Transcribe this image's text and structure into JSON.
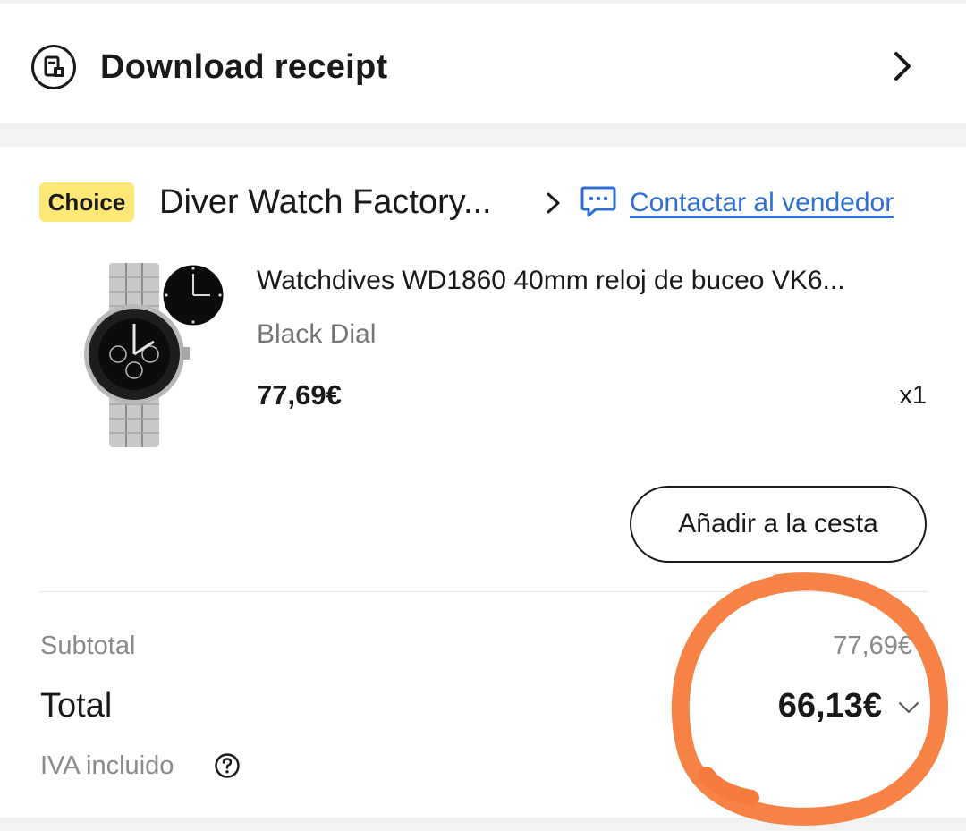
{
  "receipt": {
    "icon": "receipt-icon",
    "title": "Download receipt",
    "chevron_icon": "chevron-right-icon"
  },
  "store": {
    "badge": "Choice",
    "badge_color": "#fde777",
    "name": "Diver Watch Factory...",
    "contact_icon": "chat-icon",
    "contact_label": "Contactar al vendedor",
    "link_color": "#2e6fd6"
  },
  "product": {
    "title": "Watchdives WD1860 40mm reloj de buceo VK6...",
    "variant": "Black Dial",
    "price": "77,69€",
    "quantity": "x1"
  },
  "actions": {
    "add_to_cart": "Añadir a la cesta"
  },
  "summary": {
    "subtotal_label": "Subtotal",
    "subtotal_value": "77,69€",
    "total_label": "Total",
    "total_value": "66,13€",
    "vat_label": "IVA incluido",
    "help_icon": "question-circle-icon",
    "expand_icon": "chevron-down-icon"
  },
  "annotation_color": "#f57b3c"
}
